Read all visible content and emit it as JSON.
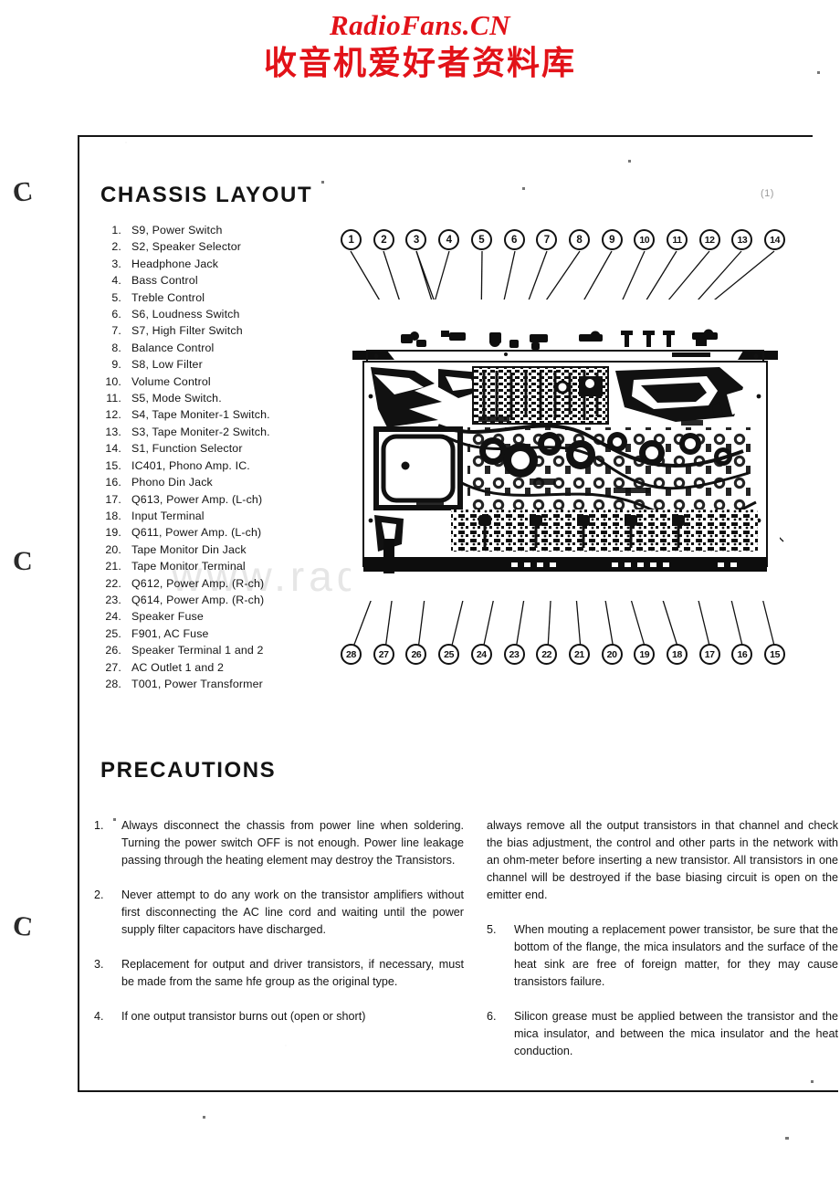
{
  "watermark": {
    "latin": "RadioFans.CN",
    "cjk": "收音机爱好者资料库",
    "mid": "www.radiofans.cn",
    "accent_color": "#e21218"
  },
  "page": {
    "marker": "(1)"
  },
  "chassis": {
    "title": "CHASSIS LAYOUT",
    "items": [
      {
        "num": "1.",
        "label": "S9, Power Switch"
      },
      {
        "num": "2.",
        "label": "S2, Speaker Selector"
      },
      {
        "num": "3.",
        "label": "Headphone Jack"
      },
      {
        "num": "4.",
        "label": "Bass Control"
      },
      {
        "num": "5.",
        "label": "Treble Control"
      },
      {
        "num": "6.",
        "label": "S6, Loudness Switch"
      },
      {
        "num": "7.",
        "label": "S7, High Filter Switch"
      },
      {
        "num": "8.",
        "label": "Balance Control"
      },
      {
        "num": "9.",
        "label": "S8, Low Filter"
      },
      {
        "num": "10.",
        "label": "Volume Control"
      },
      {
        "num": "11.",
        "label": "S5, Mode Switch."
      },
      {
        "num": "12.",
        "label": "S4, Tape Moniter-1 Switch."
      },
      {
        "num": "13.",
        "label": "S3, Tape Moniter-2 Switch."
      },
      {
        "num": "14.",
        "label": "S1, Function Selector"
      },
      {
        "num": "15.",
        "label": "IC401, Phono Amp. IC."
      },
      {
        "num": "16.",
        "label": "Phono Din Jack"
      },
      {
        "num": "17.",
        "label": "Q613, Power Amp. (L-ch)"
      },
      {
        "num": "18.",
        "label": "Input Terminal"
      },
      {
        "num": "19.",
        "label": "Q611, Power Amp. (L-ch)"
      },
      {
        "num": "20.",
        "label": "Tape Monitor Din Jack"
      },
      {
        "num": "21.",
        "label": "Tape Monitor Terminal"
      },
      {
        "num": "22.",
        "label": "Q612, Power Amp. (R-ch)"
      },
      {
        "num": "23.",
        "label": "Q614, Power Amp. (R-ch)"
      },
      {
        "num": "24.",
        "label": "Speaker Fuse"
      },
      {
        "num": "25.",
        "label": "F901, AC Fuse"
      },
      {
        "num": "26.",
        "label": "Speaker Terminal 1 and 2"
      },
      {
        "num": "27.",
        "label": "AC Outlet 1 and 2"
      },
      {
        "num": "28.",
        "label": "T001, Power Transformer"
      }
    ],
    "callouts_top": [
      "1",
      "2",
      "3",
      "4",
      "5",
      "6",
      "7",
      "8",
      "9",
      "10",
      "11",
      "12",
      "13",
      "14"
    ],
    "callouts_bottom": [
      "28",
      "27",
      "26",
      "25",
      "24",
      "23",
      "22",
      "21",
      "20",
      "19",
      "18",
      "17",
      "16",
      "15"
    ]
  },
  "precautions": {
    "title": "PRECAUTIONS",
    "left": [
      {
        "num": "1.",
        "text": "Always disconnect the chassis from power line when soldering. Turning the power switch OFF is not enough. Power line leakage passing through the heating element may destroy the Transistors."
      },
      {
        "num": "2.",
        "text": "Never attempt to do any work on the transistor amplifiers without first disconnecting the AC line cord and waiting until the power supply filter capacitors have discharged."
      },
      {
        "num": "3.",
        "text": "Replacement for output and driver transistors, if necessary, must be made from the same hfe group as the original type."
      },
      {
        "num": "4.",
        "text": "If one output transistor burns out (open or short)"
      }
    ],
    "right_continuation": "always remove all the output transistors in that channel and check the bias adjustment, the control and other parts in the network with an ohm-meter before inserting a new transistor. All transistors in one channel will be destroyed if the base biasing circuit is open on the emitter end.",
    "right": [
      {
        "num": "5.",
        "text": "When mouting a replacement power transistor, be sure that the bottom of the flange, the mica insulators and the surface of the heat sink are free of foreign matter, for they may cause transistors failure."
      },
      {
        "num": "6.",
        "text": "Silicon grease must be applied between the transistor and the mica insulator, and between the mica insulator and the heat conduction."
      }
    ]
  },
  "artifacts": {
    "hole_glyphs": [
      "C",
      "C",
      "C"
    ]
  }
}
